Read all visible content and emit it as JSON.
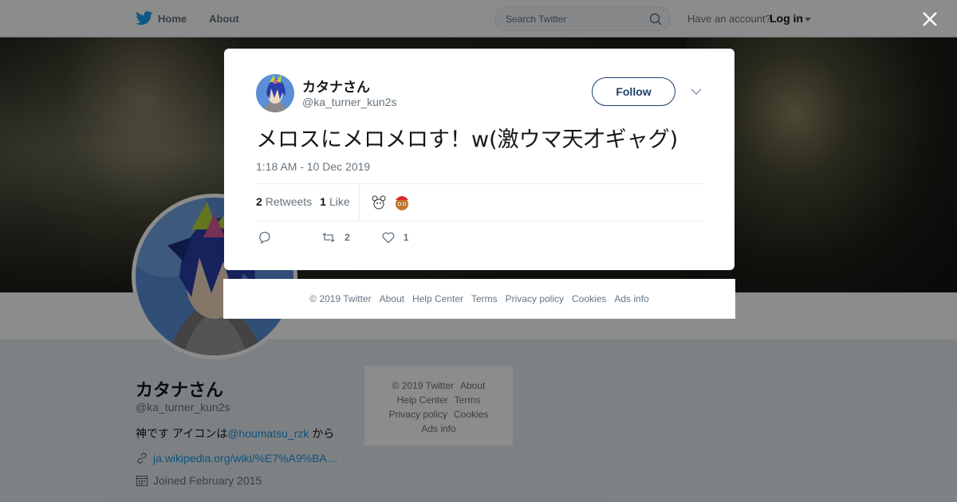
{
  "nav": {
    "home_label": "Home",
    "about_label": "About",
    "search_placeholder": "Search Twitter",
    "account_prompt": "Have an account?",
    "login_label": "Log in"
  },
  "profile": {
    "name": "カタナさん",
    "handle": "@ka_turner_kun2s",
    "bio_prefix": "神です アイコンは",
    "bio_mention": "@houmatsu_rzk",
    "bio_suffix": " から",
    "url": "ja.wikipedia.org/wiki/%E7%A9%BA…",
    "joined": "Joined February 2015"
  },
  "side_footer": {
    "copyright": "© 2019 Twitter",
    "about": "About",
    "help": "Help Center",
    "terms": "Terms",
    "privacy": "Privacy policy",
    "cookies": "Cookies",
    "ads": "Ads info"
  },
  "tweet": {
    "author_name": "カタナさん",
    "author_handle": "@ka_turner_kun2s",
    "follow_label": "Follow",
    "text": "メロスにメロメロす！w(激ウマ天才ギャグ)",
    "timestamp": "1:18 AM - 10 Dec 2019",
    "retweets_count": "2",
    "retweets_label": "Retweets",
    "likes_count": "1",
    "likes_label": "Like",
    "action_retweet_count": "2",
    "action_like_count": "1"
  },
  "modal_footer": {
    "copyright": "© 2019 Twitter",
    "about": "About",
    "help": "Help Center",
    "terms": "Terms",
    "privacy": "Privacy policy",
    "cookies": "Cookies",
    "ads": "Ads info"
  },
  "colors": {
    "twitter_blue": "#1da1f2",
    "link_blue": "#1b95e0",
    "follow_navy": "#1d3e6b"
  }
}
